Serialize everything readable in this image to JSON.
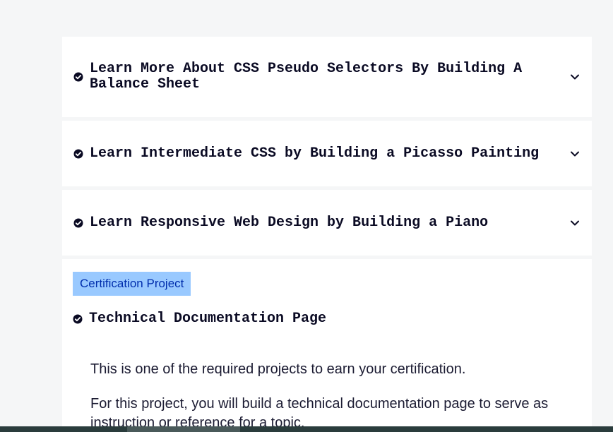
{
  "blocks": [
    {
      "title": "Learn More About CSS Pseudo Selectors By Building A Balance Sheet",
      "completed": true,
      "expanded": false
    },
    {
      "title": "Learn Intermediate CSS by Building a Picasso Painting",
      "completed": true,
      "expanded": false
    },
    {
      "title": "Learn Responsive Web Design by Building a Piano",
      "completed": true,
      "expanded": false
    }
  ],
  "certification": {
    "badge": "Certification Project",
    "title": "Technical Documentation Page",
    "completed": true,
    "paragraphs": [
      "This is one of the required projects to earn your certification.",
      "For this project, you will build a technical documentation page to serve as instruction or reference for a topic."
    ]
  },
  "colors": {
    "background": "#f5f6f7",
    "card": "#ffffff",
    "text": "#0a0a23",
    "badge_bg": "#99c9ff",
    "badge_text": "#002ead"
  },
  "icons": {
    "completed": "check-circle-icon",
    "expand": "chevron-down-icon"
  }
}
